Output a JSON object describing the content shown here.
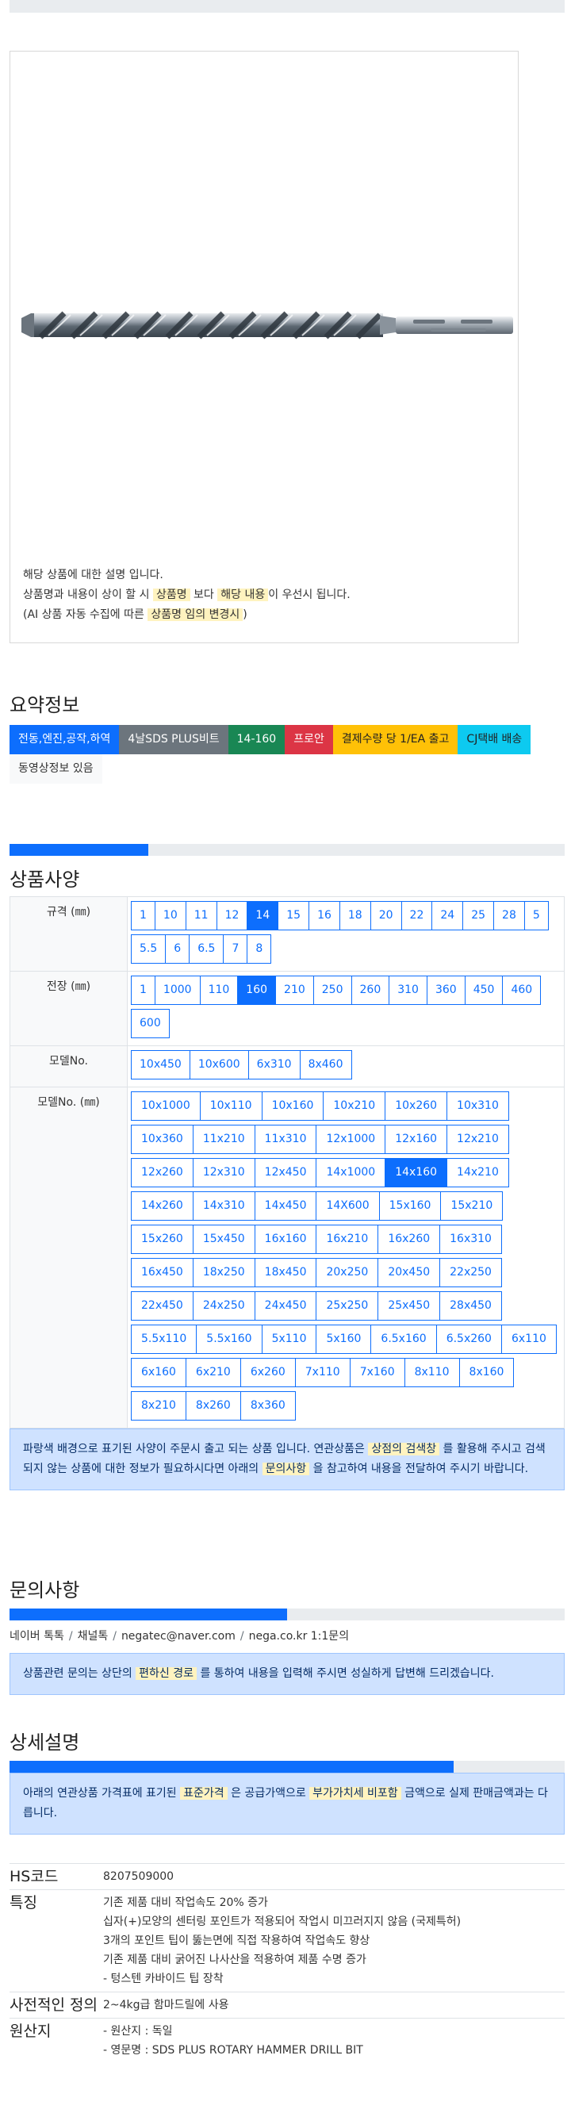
{
  "image": {
    "caption": [
      {
        "text": "해당 상품에 대한 설명 입니다."
      },
      {
        "before": "상품명과 내용이 상이 할 시 ",
        "hl1": "상품명",
        "mid": " 보다 ",
        "hl2": "해당 내용",
        "after": "이 우선시 됩니다."
      },
      {
        "before": "(AI 상품 자동 수집에 따른 ",
        "hl1": "상품명 임의 변경시",
        "after": ")"
      }
    ]
  },
  "summary": {
    "title": "요약정보",
    "badges": [
      {
        "label": "전동,엔진,공작,하역",
        "color": "blue"
      },
      {
        "label": "4날SDS PLUS비트",
        "color": "gray"
      },
      {
        "label": "14-160",
        "color": "green"
      },
      {
        "label": "프로안",
        "color": "red"
      },
      {
        "label": "결제수량 당 1/EA 출고",
        "color": "yellow"
      },
      {
        "label": "CJ택배 배송",
        "color": "cyan"
      },
      {
        "label": "동영상정보 있음",
        "color": "light"
      }
    ]
  },
  "spec": {
    "title": "상품사양",
    "progress": 0.25,
    "rows": [
      {
        "label": "규격 (㎜)",
        "options": [
          "1",
          "10",
          "11",
          "12",
          "14",
          "15",
          "16",
          "18",
          "20",
          "22",
          "24",
          "25",
          "28",
          "5",
          "5.5",
          "6",
          "6.5",
          "7",
          "8"
        ],
        "active": "14"
      },
      {
        "label": "전장 (㎜)",
        "options": [
          "1",
          "1000",
          "110",
          "160",
          "210",
          "250",
          "260",
          "310",
          "360",
          "450",
          "460",
          "600"
        ],
        "active": "160"
      },
      {
        "label": "모델No.",
        "options": [
          "10x450",
          "10x600",
          "6x310",
          "8x460"
        ],
        "active": ""
      },
      {
        "label": "모델No. (㎜)",
        "options": [
          "10x1000",
          "10x110",
          "10x160",
          "10x210",
          "10x260",
          "10x310",
          "10x360",
          "11x210",
          "11x310",
          "12x1000",
          "12x160",
          "12x210",
          "12x260",
          "12x310",
          "12x450",
          "14x1000",
          "14x160",
          "14x210",
          "14x260",
          "14x310",
          "14x450",
          "14X600",
          "15x160",
          "15x210",
          "15x260",
          "15x450",
          "16x160",
          "16x210",
          "16x260",
          "16x310",
          "16x450",
          "18x250",
          "18x450",
          "20x250",
          "20x450",
          "22x250",
          "22x450",
          "24x250",
          "24x450",
          "25x250",
          "25x450",
          "28x450",
          "5.5x110",
          "5.5x160",
          "5x110",
          "5x160",
          "6.5x160",
          "6.5x260",
          "6x110",
          "6x160",
          "6x210",
          "6x260",
          "7x110",
          "7x160",
          "8x110",
          "8x160",
          "8x210",
          "8x260",
          "8x360"
        ],
        "active": "14x160"
      }
    ],
    "notice": {
      "p1": "파랑색 배경으로 표기된 사양이 주문시 출고 되는 상품 입니다. 연관상품은 ",
      "hl1": "상점의 검색창",
      "p2": " 를 활용해 주시고 검색되지 않는 상품에 대한 정보가 필요하시다면 아래의 ",
      "hl2": "문의사항",
      "p3": " 을 참고하여 내용을 전달하여 주시기 바랍니다."
    }
  },
  "inquiry": {
    "title": "문의사항",
    "progress": 0.5,
    "contacts": [
      "네이버 톡톡",
      "채널톡",
      "negatec@naver.com",
      "nega.co.kr 1:1문의"
    ],
    "notice": {
      "p1": "상품관련 문의는 상단의 ",
      "hl1": "편하신 경로",
      "p2": " 를 통하여 내용을 입력해 주시면 성실하게 답변해 드리겠습니다."
    }
  },
  "detail": {
    "title": "상세설명",
    "progress": 0.8,
    "notice": {
      "p1": "아래의 연관상품 가격표에 표기된 ",
      "hl1": "표준가격",
      "p2": " 은 공급가액으로 ",
      "hl2": "부가가치세 비포함",
      "p3": " 금액으로 실제 판매금액과는 다릅니다."
    },
    "info": [
      {
        "key": "HS코드",
        "lines": [
          "8207509000"
        ]
      },
      {
        "key": "특징",
        "lines": [
          "기존 제품 대비 작업속도 20% 증가",
          "십자(+)모양의 센터링 포인트가 적용되어 작업시 미끄러지지 않음 (국제특허)",
          "3개의 포인트 팁이 뚫는면에 직접 작용하여 작업속도 향상",
          "기존 제품 대비 굵어진 나사산을 적용하여 제품 수명 증가",
          "- 텅스텐 카바이드 팁 장착"
        ]
      },
      {
        "key": "사전적인 정의",
        "lines": [
          "2~4kg급 함마드릴에 사용"
        ]
      },
      {
        "key": "원산지",
        "lines": [
          "- 원산지 : 독일",
          "- 영문명 : SDS PLUS ROTARY HAMMER DRILL BIT"
        ]
      }
    ]
  },
  "colors": {
    "primary": "#0d6efd",
    "highlight": "#fff3bf",
    "alert_bg": "#cfe2ff"
  }
}
